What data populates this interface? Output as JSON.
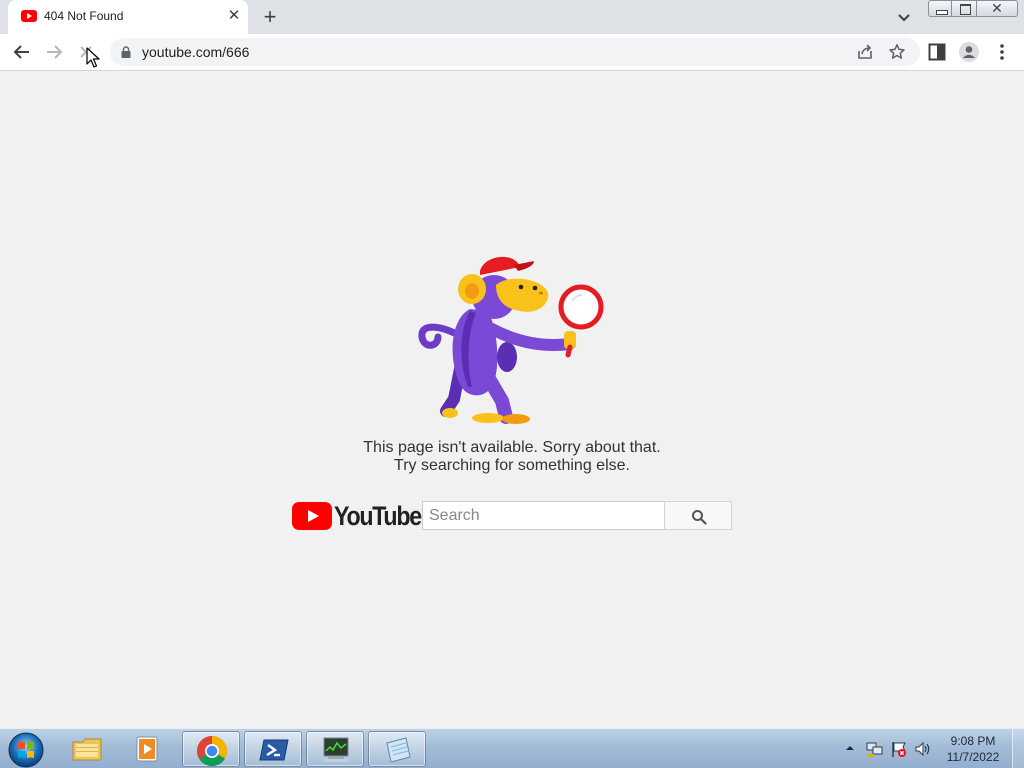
{
  "browser": {
    "tab": {
      "title": "404 Not Found",
      "favicon": "youtube-favicon-icon",
      "close_icon": "close-icon"
    },
    "new_tab_icon": "plus-icon",
    "tab_search_icon": "chevron-down-icon",
    "window_controls": [
      "minimize-icon",
      "maximize-icon",
      "close-icon"
    ],
    "close_glyph": "✕",
    "toolbar": {
      "back_icon": "arrow-left-icon",
      "forward_icon": "arrow-right-icon",
      "stop_icon": "close-icon",
      "url": "youtube.com/666",
      "lock_icon": "lock-icon",
      "share_icon": "share-icon",
      "bookmark_icon": "star-icon",
      "side_panel_icon": "side-panel-icon",
      "profile_icon": "profile-icon",
      "menu_icon": "more-vertical-icon"
    }
  },
  "page": {
    "message_line1": "This page isn't available. Sorry about that.",
    "message_line2": "Try searching for something else.",
    "logo_text": "YouTube",
    "search_placeholder": "Search",
    "search_button_icon": "search-icon",
    "brand_color": "#ff0000"
  },
  "taskbar": {
    "start_icon": "windows-start-orb-icon",
    "apps": [
      {
        "name": "windows-explorer",
        "icon": "folder-icon",
        "running": false
      },
      {
        "name": "media-player",
        "icon": "media-player-icon",
        "running": false
      },
      {
        "name": "google-chrome",
        "icon": "chrome-icon",
        "running": true
      },
      {
        "name": "powershell",
        "icon": "powershell-icon",
        "running": true
      },
      {
        "name": "task-manager",
        "icon": "task-manager-icon",
        "running": true
      },
      {
        "name": "notes",
        "icon": "notepad-icon",
        "running": true
      }
    ],
    "tray": {
      "show_hidden_icon": "chevron-up-icon",
      "network_icon": "network-icon",
      "action_center_icon": "flag-icon",
      "volume_icon": "speaker-icon"
    },
    "clock_time": "9:08 PM",
    "clock_date": "11/7/2022"
  }
}
